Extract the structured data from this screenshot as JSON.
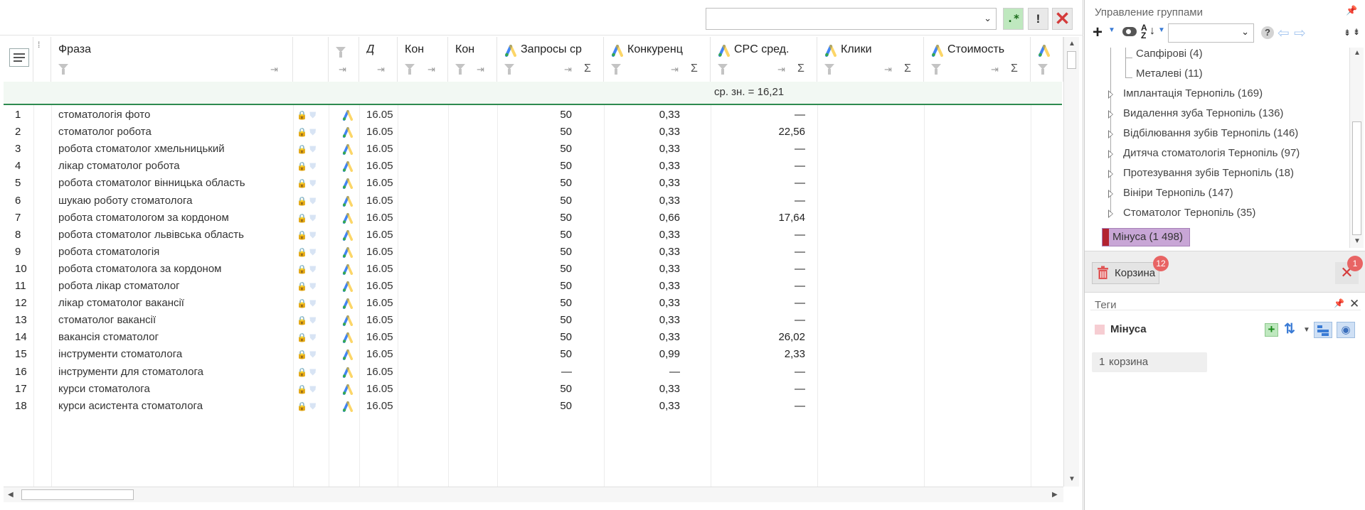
{
  "toolbar": {
    "regex_label": ".*",
    "exclaim_label": "!",
    "filter_value": ""
  },
  "columns": {
    "phrase": "Фраза",
    "d": "Д",
    "kom1": "Кон",
    "kom2": "Кон",
    "zapros": "Запросы ср",
    "konkur": "Конкуренц",
    "cpc": "CPC сред.",
    "kliki": "Клики",
    "stoim": "Стоимость",
    "sigma": "Σ"
  },
  "avg_text": "ср. зн. = 16,21",
  "rows": [
    {
      "n": "1",
      "phrase": "стоматологія фото",
      "date": "16.05",
      "zap": "50",
      "kon": "0,33",
      "cpc": "—"
    },
    {
      "n": "2",
      "phrase": "стоматолог робота",
      "date": "16.05",
      "zap": "50",
      "kon": "0,33",
      "cpc": "22,56"
    },
    {
      "n": "3",
      "phrase": "робота стоматолог хмельницький",
      "date": "16.05",
      "zap": "50",
      "kon": "0,33",
      "cpc": "—"
    },
    {
      "n": "4",
      "phrase": "лікар стоматолог робота",
      "date": "16.05",
      "zap": "50",
      "kon": "0,33",
      "cpc": "—"
    },
    {
      "n": "5",
      "phrase": "робота стоматолог вінницька область",
      "date": "16.05",
      "zap": "50",
      "kon": "0,33",
      "cpc": "—"
    },
    {
      "n": "6",
      "phrase": "шукаю роботу стоматолога",
      "date": "16.05",
      "zap": "50",
      "kon": "0,33",
      "cpc": "—"
    },
    {
      "n": "7",
      "phrase": "робота стоматологом за кордоном",
      "date": "16.05",
      "zap": "50",
      "kon": "0,66",
      "cpc": "17,64"
    },
    {
      "n": "8",
      "phrase": "робота стоматолог львівська область",
      "date": "16.05",
      "zap": "50",
      "kon": "0,33",
      "cpc": "—"
    },
    {
      "n": "9",
      "phrase": "робота стоматологія",
      "date": "16.05",
      "zap": "50",
      "kon": "0,33",
      "cpc": "—"
    },
    {
      "n": "10",
      "phrase": "робота стоматолога за кордоном",
      "date": "16.05",
      "zap": "50",
      "kon": "0,33",
      "cpc": "—"
    },
    {
      "n": "11",
      "phrase": "робота лікар стоматолог",
      "date": "16.05",
      "zap": "50",
      "kon": "0,33",
      "cpc": "—"
    },
    {
      "n": "12",
      "phrase": "лікар стоматолог вакансії",
      "date": "16.05",
      "zap": "50",
      "kon": "0,33",
      "cpc": "—"
    },
    {
      "n": "13",
      "phrase": "стоматолог вакансії",
      "date": "16.05",
      "zap": "50",
      "kon": "0,33",
      "cpc": "—"
    },
    {
      "n": "14",
      "phrase": "вакансія стоматолог",
      "date": "16.05",
      "zap": "50",
      "kon": "0,33",
      "cpc": "26,02"
    },
    {
      "n": "15",
      "phrase": "інструменти стоматолога",
      "date": "16.05",
      "zap": "50",
      "kon": "0,99",
      "cpc": "2,33"
    },
    {
      "n": "16",
      "phrase": "інструменти для стоматолога",
      "date": "16.05",
      "zap": "—",
      "kon": "—",
      "cpc": "—"
    },
    {
      "n": "17",
      "phrase": "курси стоматолога",
      "date": "16.05",
      "zap": "50",
      "kon": "0,33",
      "cpc": "—"
    },
    {
      "n": "18",
      "phrase": "курси асистента стоматолога",
      "date": "16.05",
      "zap": "50",
      "kon": "0,33",
      "cpc": "—"
    }
  ],
  "groups_panel": {
    "title": "Управление группами",
    "tree": [
      {
        "label": "Сапфірові (4)",
        "expandable": false
      },
      {
        "label": "Металеві (11)",
        "expandable": false
      },
      {
        "label": "Імплантація Тернопіль (169)",
        "expandable": true
      },
      {
        "label": "Видалення зуба Тернопіль (136)",
        "expandable": true
      },
      {
        "label": "Відбілювання зубів Тернопіль (146)",
        "expandable": true
      },
      {
        "label": "Дитяча стоматологія Тернопіль (97)",
        "expandable": true
      },
      {
        "label": "Протезування зубів Тернопіль (18)",
        "expandable": true
      },
      {
        "label": "Вініри Тернопіль (147)",
        "expandable": true
      },
      {
        "label": "Стоматолог Тернопіль (35)",
        "expandable": true
      }
    ],
    "selected": "Мінуса (1 498)",
    "trash_label": "Корзина",
    "trash_badge": "12",
    "close_badge": "1"
  },
  "tags_panel": {
    "title": "Теги",
    "tag_name": "Мінуса",
    "tag_item_num": "1",
    "tag_item_label": "корзина"
  },
  "colors": {
    "accent_green": "#2e8b4f",
    "selected_bg": "#c8a6d6",
    "minus_marker": "#b22230",
    "badge": "#e86464"
  }
}
